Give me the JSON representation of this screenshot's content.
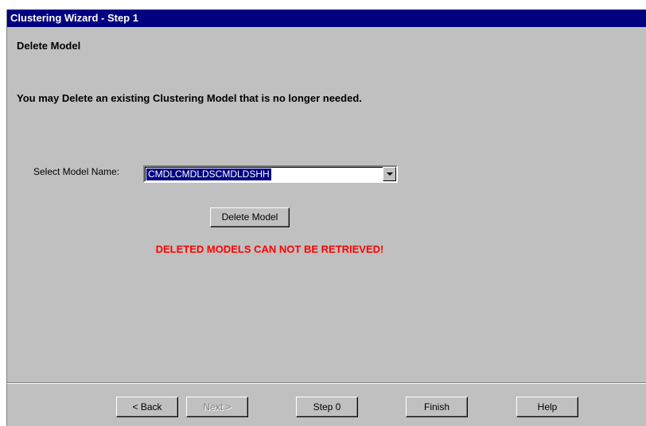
{
  "window": {
    "title": "Clustering Wizard - Step 1"
  },
  "page": {
    "heading": "Delete Model",
    "description": "You may Delete an existing Clustering Model that is no longer needed.",
    "select_label": "Select Model Name:",
    "selected_model": "CMDLCMDLDSCMDLDSHH",
    "delete_button": "Delete Model",
    "warning": "DELETED MODELS CAN NOT BE RETRIEVED!"
  },
  "footer": {
    "back": "< Back",
    "next": "Next >",
    "step0": "Step 0",
    "finish": "Finish",
    "help": "Help"
  },
  "colors": {
    "title_bar": "#000080",
    "dialog_background": "#c0c0c0",
    "warning_text": "#ff0000",
    "selection_highlight": "#000080",
    "disabled_text": "#808080"
  },
  "icons": {
    "combo_dropdown": "chevron-down-icon"
  }
}
